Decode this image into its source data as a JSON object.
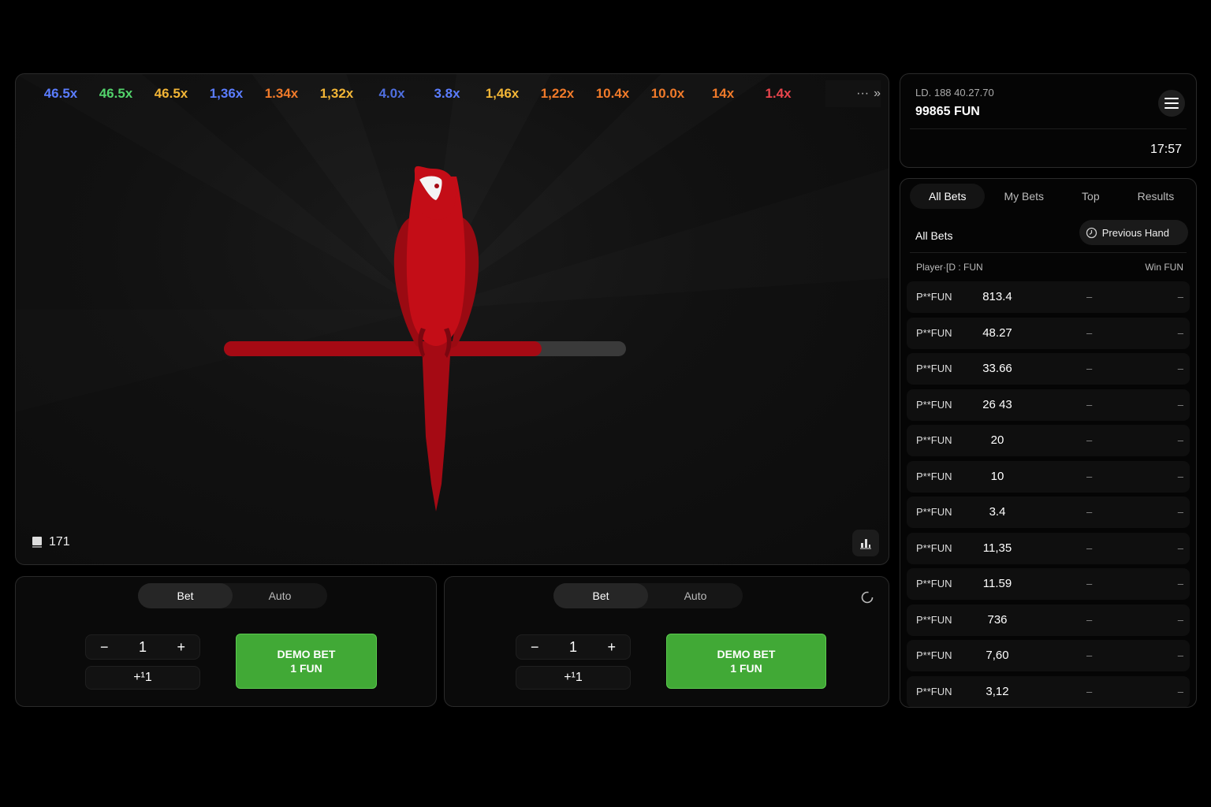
{
  "history": [
    {
      "value": "46.5x",
      "color": "#5b7dff"
    },
    {
      "value": "46.5x",
      "color": "#52d36b"
    },
    {
      "value": "46.5x",
      "color": "#f2b536"
    },
    {
      "value": "1,36x",
      "color": "#5b7dff"
    },
    {
      "value": "1.34x",
      "color": "#f07a2a"
    },
    {
      "value": "1,32x",
      "color": "#f2b536"
    },
    {
      "value": "4.0x",
      "color": "#4f6fe0"
    },
    {
      "value": "3.8x",
      "color": "#5b7dff"
    },
    {
      "value": "1,46x",
      "color": "#f2b536"
    },
    {
      "value": "1,22x",
      "color": "#f07a2a"
    },
    {
      "value": "10.4x",
      "color": "#f07a2a"
    },
    {
      "value": "10.0x",
      "color": "#f07a2a"
    },
    {
      "value": "14x",
      "color": "#f07a2a"
    },
    {
      "value": "1.4x",
      "color": "#e8444c"
    }
  ],
  "history_more": "···",
  "history_next": "»",
  "round_counter": "171",
  "progress": 0.79,
  "bet_panels": [
    {
      "tabs": [
        "Bet",
        "Auto"
      ],
      "active_tab": "Bet",
      "amount": "1",
      "minus": "−",
      "plus": "+",
      "quick": "+¹1",
      "button_line1": "DEMO BET",
      "button_line2": "1 FUN"
    },
    {
      "tabs": [
        "Bet",
        "Auto"
      ],
      "active_tab": "Bet",
      "amount": "1",
      "minus": "−",
      "plus": "+",
      "quick": "+¹1",
      "button_line1": "DEMO BET",
      "button_line2": "1 FUN"
    }
  ],
  "account": {
    "id": "LD. 188 40.27.70",
    "balance": "99865 FUN",
    "time": "17:57"
  },
  "bets_tabs": [
    "All Bets",
    "My Bets",
    "Top",
    "Results"
  ],
  "bets_active_tab": "All Bets",
  "bets_title": "All Bets",
  "previous_hand": "Previous Hand",
  "columns": {
    "player": "Player·[D : FUN",
    "win": "Win FUN"
  },
  "rows": [
    {
      "player": "P**FUN",
      "bet": "813.4",
      "mult": "–",
      "win": "–"
    },
    {
      "player": "P**FUN",
      "bet": "48.27",
      "mult": "–",
      "win": "–"
    },
    {
      "player": "P**FUN",
      "bet": "33.66",
      "mult": "–",
      "win": "–"
    },
    {
      "player": "P**FUN",
      "bet": "26 43",
      "mult": "–",
      "win": "–"
    },
    {
      "player": "P**FUN",
      "bet": "20",
      "mult": "–",
      "win": "–"
    },
    {
      "player": "P**FUN",
      "bet": "10",
      "mult": "–",
      "win": "–"
    },
    {
      "player": "P**FUN",
      "bet": "3.4",
      "mult": "–",
      "win": "–"
    },
    {
      "player": "P**FUN",
      "bet": "11,35",
      "mult": "–",
      "win": "–"
    },
    {
      "player": "P**FUN",
      "bet": "11.59",
      "mult": "–",
      "win": "–"
    },
    {
      "player": "P**FUN",
      "bet": "736",
      "mult": "–",
      "win": "–"
    },
    {
      "player": "P**FUN",
      "bet": "7,60",
      "mult": "–",
      "win": "–"
    },
    {
      "player": "P**FUN",
      "bet": "3,12",
      "mult": "–",
      "win": "–"
    }
  ],
  "colors": {
    "accent_green": "#41a936",
    "parrot_red": "#c40d17",
    "perch_red": "#a50a14"
  }
}
